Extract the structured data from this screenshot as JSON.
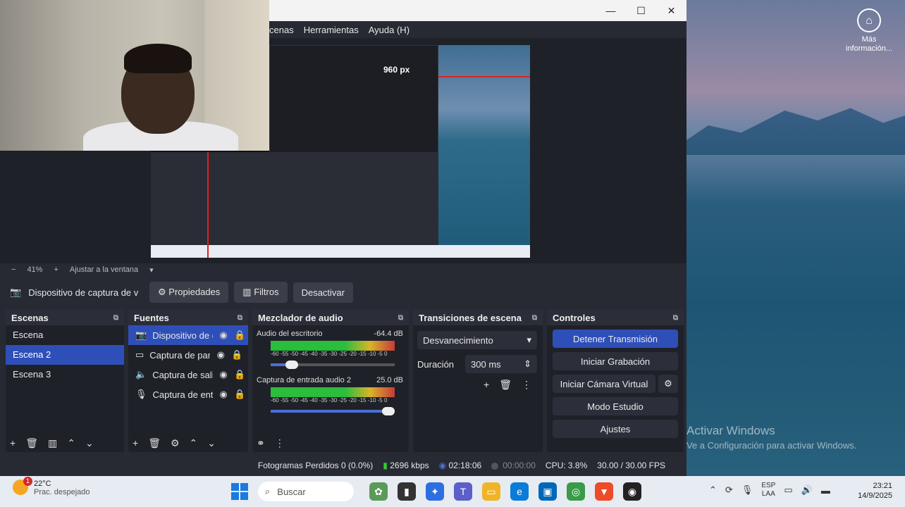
{
  "desktop": {
    "icon_label": "Más información...",
    "activate_title": "Activar Windows",
    "activate_sub": "Ve a Configuración para activar Windows."
  },
  "window": {
    "menu": [
      "cenas",
      "Herramientas",
      "Ayuda (H)"
    ]
  },
  "preview": {
    "px_label": "960 px",
    "zoom": "41%",
    "fit": "Ajustar a la ventana"
  },
  "source_toolbar": {
    "source_name": "Dispositivo de captura de v",
    "properties": "Propiedades",
    "filters": "Filtros",
    "deactivate": "Desactivar"
  },
  "scenes": {
    "title": "Escenas",
    "items": [
      "Escena",
      "Escena 2",
      "Escena 3"
    ],
    "selected": "Escena 2"
  },
  "sources": {
    "title": "Fuentes",
    "items": [
      {
        "name": "Dispositivo de c",
        "icon": "camera-icon"
      },
      {
        "name": "Captura de par",
        "icon": "monitor-icon"
      },
      {
        "name": "Captura de sali",
        "icon": "speaker-icon"
      },
      {
        "name": "Captura de ent",
        "icon": "microphone-icon"
      }
    ]
  },
  "mixer": {
    "title": "Mezclador de audio",
    "channels": [
      {
        "name": "Audio del escritorio",
        "level": "-64.4 dB",
        "volume": 0.17
      },
      {
        "name": "Captura de entrada audio 2",
        "level": "25.0 dB",
        "volume": 0.95
      }
    ],
    "scale": "-60 -55 -50 -45 -40 -35 -30 -25 -20 -15 -10 -5 0"
  },
  "transitions": {
    "title": "Transiciones de escena",
    "selected": "Desvanecimiento",
    "duration_label": "Duración",
    "duration_value": "300 ms"
  },
  "controls": {
    "title": "Controles",
    "stop_stream": "Detener Transmisión",
    "start_record": "Iniciar Grabación",
    "virtual_cam": "Iniciar Cámara Virtual",
    "studio_mode": "Modo Estudio",
    "settings": "Ajustes"
  },
  "status": {
    "dropped": "Fotogramas Perdidos 0 (0.0%)",
    "bitrate": "2696 kbps",
    "stream_time": "02:18:06",
    "rec_time": "00:00:00",
    "cpu": "CPU: 3.8%",
    "fps": "30.00 / 30.00 FPS"
  },
  "taskbar": {
    "weather_temp": "22°C",
    "weather_desc": "Prac. despejado",
    "weather_badge": "1",
    "search_placeholder": "Buscar",
    "lang_top": "ESP",
    "lang_bottom": "LAA",
    "time": "23:21",
    "date": "14/9/2025"
  },
  "colors": {
    "accent": "#2f4fb8",
    "dock_bg": "#1f2128",
    "window_bg": "#272a33"
  }
}
